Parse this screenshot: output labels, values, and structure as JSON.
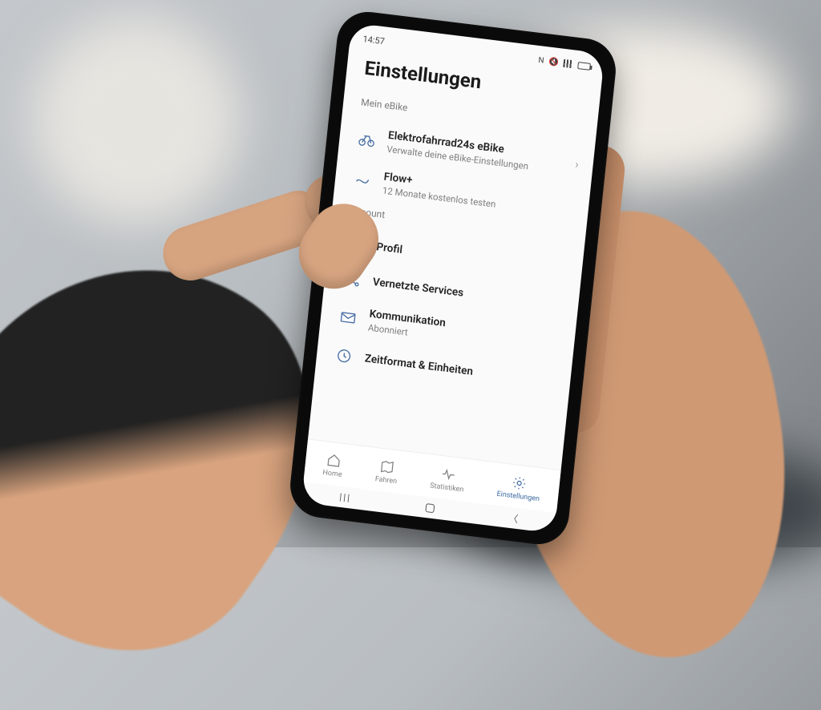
{
  "status": {
    "time": "14:57",
    "nfc": "N"
  },
  "screen_title": "Einstellungen",
  "sections": {
    "ebike": {
      "label": "Mein eBike",
      "items": [
        {
          "title": "Elektrofahrrad24s eBike",
          "subtitle": "Verwalte deine eBike-Einstellungen"
        },
        {
          "title": "Flow+",
          "subtitle": "12 Monate kostenlos testen"
        }
      ]
    },
    "account": {
      "label": "Account",
      "items": [
        {
          "title": "Profil",
          "subtitle": ""
        },
        {
          "title": "Vernetzte Services",
          "subtitle": ""
        },
        {
          "title": "Kommunikation",
          "subtitle": "Abonniert"
        },
        {
          "title": "Zeitformat & Einheiten",
          "subtitle": ""
        }
      ]
    }
  },
  "tabs": [
    {
      "label": "Home"
    },
    {
      "label": "Fahren"
    },
    {
      "label": "Statistiken"
    },
    {
      "label": "Einstellungen"
    }
  ]
}
